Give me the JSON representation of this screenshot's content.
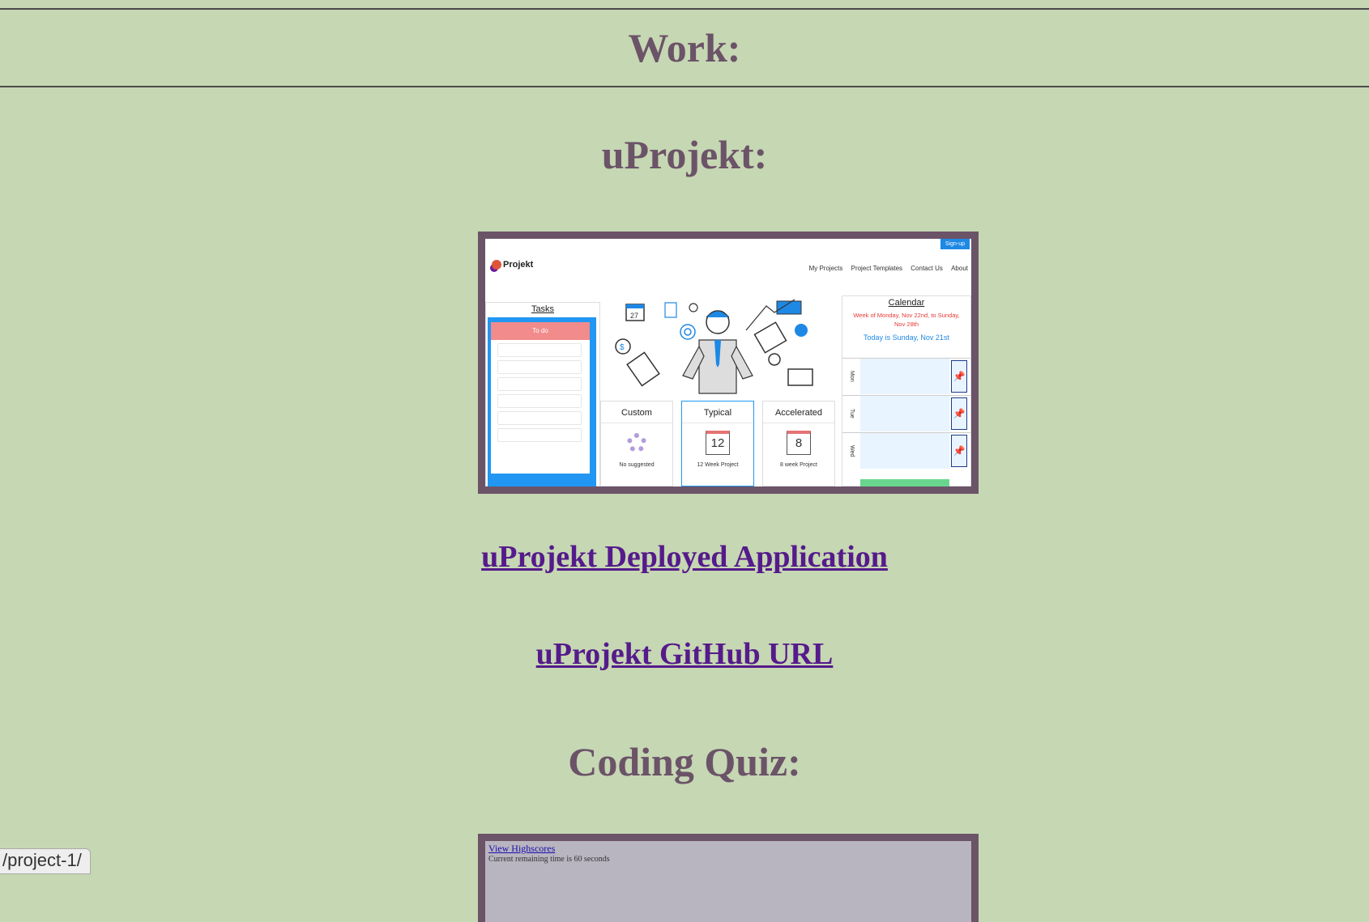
{
  "work_heading": "Work:",
  "projects": [
    {
      "title": "uProjekt:",
      "deployed_link": "uProjekt Deployed Application",
      "github_link": "uProjekt GitHub URL",
      "screenshot": {
        "signup": "Sign-up",
        "logo": "Projekt",
        "nav": [
          "My Projects",
          "Project Templates",
          "Contact Us",
          "About"
        ],
        "tasks_title": "Tasks",
        "todo_label": "To do",
        "calendar_icon_number": "27",
        "cards": [
          {
            "title": "Custom",
            "footer": "No suggested"
          },
          {
            "title": "Typical",
            "number": "12",
            "footer": "12 Week Project"
          },
          {
            "title": "Accelerated",
            "number": "8",
            "footer": "8 week Project"
          }
        ],
        "calendar_title": "Calendar",
        "calendar_week": "Week of Monday, Nov 22nd, to Sunday, Nov 28th",
        "calendar_today": "Today is Sunday, Nov 21st",
        "days": [
          "Mon",
          "Tue",
          "Wed"
        ]
      }
    },
    {
      "title": "Coding Quiz:",
      "screenshot": {
        "highscores_link": "View Highscores",
        "timer_text": "Current remaining time is 60 seconds"
      }
    }
  ],
  "status_url": "/project-1/",
  "colors": {
    "background": "#c6d7b3",
    "heading": "#6b5368",
    "link": "#551a8b",
    "frame": "#6b5368"
  }
}
